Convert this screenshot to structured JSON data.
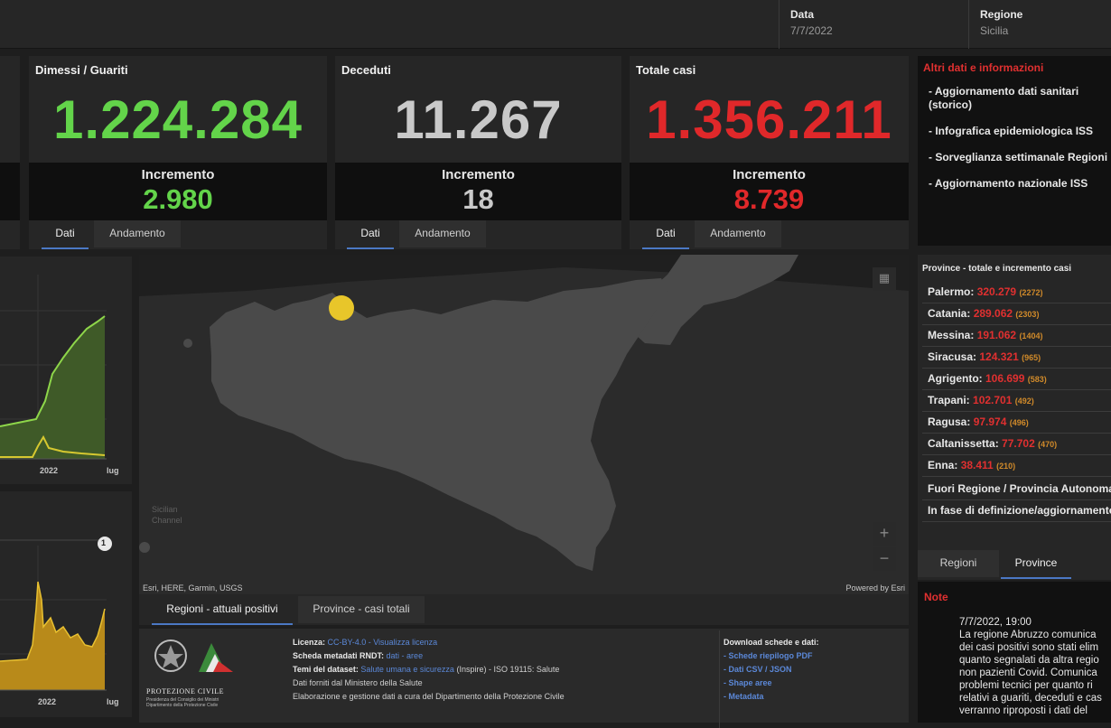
{
  "header": {
    "date_label": "Data",
    "date_value": "7/7/2022",
    "region_label": "Regione",
    "region_value": "Sicilia"
  },
  "kpis": [
    {
      "title": "Dimessi / Guariti",
      "value": "1.224.284",
      "increment_label": "Incremento",
      "increment": "2.980",
      "color": "#63d44a"
    },
    {
      "title": "Deceduti",
      "value": "11.267",
      "increment_label": "Incremento",
      "increment": "18",
      "color": "#c9c9c9"
    },
    {
      "title": "Totale casi",
      "value": "1.356.211",
      "increment_label": "Incremento",
      "increment": "8.739",
      "color": "#e0282a"
    }
  ],
  "kpi_tabs": {
    "data": "Dati",
    "trend": "Andamento"
  },
  "info": {
    "title": "Altri dati e informazioni",
    "links": [
      "- Aggiornamento dati sanitari (storico)",
      "- Infografica epidemiologica ISS",
      "- Sorveglianza settimanale Regioni",
      "- Aggiornamento nazionale ISS"
    ]
  },
  "provinces": {
    "title": "Province - totale e incremento casi",
    "rows": [
      {
        "name": "Palermo:",
        "value": "320.279",
        "inc": "(2272)"
      },
      {
        "name": "Catania:",
        "value": "289.062",
        "inc": "(2303)"
      },
      {
        "name": "Messina:",
        "value": "191.062",
        "inc": "(1404)"
      },
      {
        "name": "Siracusa:",
        "value": "124.321",
        "inc": "(965)"
      },
      {
        "name": "Agrigento:",
        "value": "106.699",
        "inc": "(583)"
      },
      {
        "name": "Trapani:",
        "value": "102.701",
        "inc": "(492)"
      },
      {
        "name": "Ragusa:",
        "value": "97.974",
        "inc": "(496)"
      },
      {
        "name": "Caltanissetta:",
        "value": "77.702",
        "inc": "(470)"
      },
      {
        "name": "Enna:",
        "value": "38.411",
        "inc": "(210)"
      },
      {
        "name": "Fuori Regione / Provincia Autonoma",
        "value": "",
        "inc": ""
      },
      {
        "name": "In fase di definizione/aggiornamento",
        "value": "",
        "inc": ""
      }
    ]
  },
  "side_tabs": {
    "regions": "Regioni",
    "provinces": "Province"
  },
  "note": {
    "label": "Note",
    "text": "7/7/2022, 19:00\nLa regione Abruzzo comunica\ndei casi positivi sono stati elim\nquanto segnalati da altra regio\nnon pazienti Covid. Comunica\nproblemi tecnici per quanto ri\nrelativi a guariti, deceduti e cas\nverranno riproposti i dati del"
  },
  "map": {
    "credits": "Esri, HERE, Garmin, USGS",
    "powered": "Powered by Esri",
    "channel_label": "Sicilian\nChannel",
    "zoom_in": "+",
    "zoom_out": "−",
    "bubble_color": "#e8c62a",
    "land_color": "#4a4a4a",
    "sea_color": "#2b2b2b"
  },
  "charts": {
    "chart1_xlabels": [
      "2022",
      "lug"
    ],
    "chart2_xlabels": [
      "2022",
      "lug"
    ],
    "chart2_badge": "1"
  },
  "bottom_tabs": {
    "regions": "Regioni - attuali positivi",
    "provinces": "Province - casi totali"
  },
  "footer": {
    "logo_text": "PROTEZIONE CIVILE",
    "logo_sub": "Presidenza del Consiglio dei Ministri\nDipartimento della Protezione Civile",
    "license_label": "Licenza:",
    "license_link": "CC-BY-4.0 - Visualizza licenza",
    "meta_label": "Scheda metadati RNDT:",
    "meta_links": "dati - aree",
    "topics_label": "Temi del dataset:",
    "topics_link": "Salute umana e sicurezza",
    "topics_rest": "(Inspire) - ISO 19115: Salute",
    "source": "Dati forniti dal Ministero della Salute",
    "processing": "Elaborazione e gestione dati a cura del Dipartimento della Protezione Civile",
    "download_title": "Download schede e dati:",
    "download_links": [
      "- Schede riepilogo PDF",
      "- Dati CSV / JSON",
      "- Shape aree",
      "- Metadata"
    ]
  }
}
